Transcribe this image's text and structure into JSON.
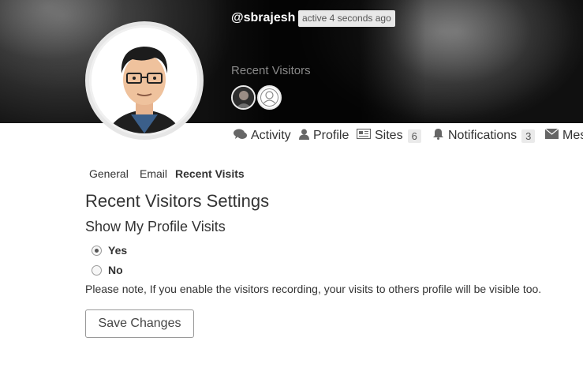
{
  "header": {
    "username": "@sbrajesh",
    "active_status": "active 4 seconds ago",
    "recent_visitors_label": "Recent Visitors"
  },
  "nav": {
    "tabs": [
      {
        "label": "Activity",
        "icon": "comments-icon",
        "count": ""
      },
      {
        "label": "Profile",
        "icon": "user-icon",
        "count": ""
      },
      {
        "label": "Sites",
        "icon": "newspaper-icon",
        "count": "6"
      },
      {
        "label": "Notifications",
        "icon": "bell-icon",
        "count": "3"
      },
      {
        "label": "Mes",
        "icon": "envelope-icon",
        "count": ""
      }
    ]
  },
  "subnav": {
    "general": "General",
    "email": "Email",
    "recent_visits": "Recent Visits"
  },
  "settings": {
    "title": "Recent Visitors Settings",
    "section_title": "Show My Profile Visits",
    "options": [
      {
        "label": "Yes",
        "checked": true
      },
      {
        "label": "No",
        "checked": false
      }
    ],
    "note": "Please note, If you enable the visitors recording, your visits to others profile will be visible too.",
    "save_label": "Save Changes"
  }
}
